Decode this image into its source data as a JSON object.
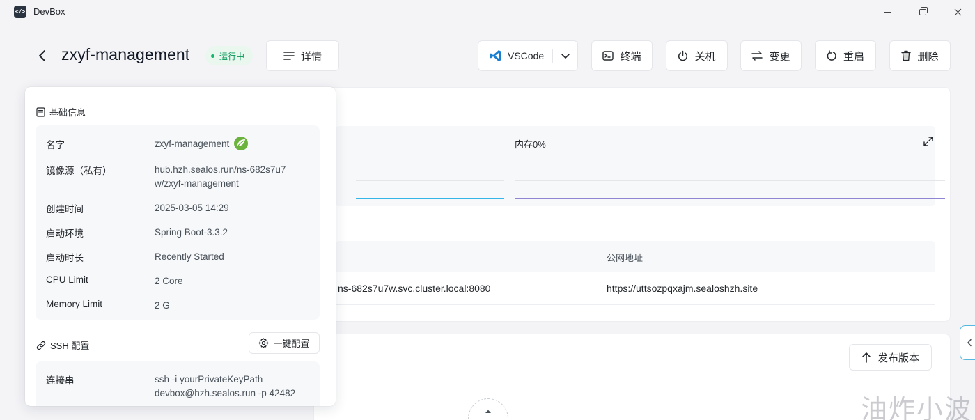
{
  "window": {
    "app_title": "DevBox",
    "app_icon": "code-icon"
  },
  "header": {
    "title": "zxyf-management",
    "status": "运行中",
    "status_color": "#12b76a"
  },
  "toolbar": {
    "detail_label": "详情",
    "vscode_label": "VSCode",
    "terminal_label": "终端",
    "shutdown_label": "关机",
    "change_label": "变更",
    "restart_label": "重启",
    "delete_label": "删除"
  },
  "monitor": {
    "memory_label": "内存0%",
    "cpu_line_color": "#36b6e6",
    "memory_line_color": "#8e86d3"
  },
  "network": {
    "public_header": "公网地址",
    "private_address": "ns-682s7u7w.svc.cluster.local:8080",
    "public_address": "https://uttsozpqxajm.sealoshzh.site"
  },
  "version": {
    "release_label": "发布版本"
  },
  "details": {
    "basic_title": "基础信息",
    "rows": [
      {
        "key": "名字",
        "value": "zxyf-management"
      },
      {
        "key": "镜像源（私有）",
        "value": "hub.hzh.sealos.run/ns-682s7u7w/zxyf-management"
      },
      {
        "key": "创建时间",
        "value": "2025-03-05 14:29"
      },
      {
        "key": "启动环境",
        "value": "Spring Boot-3.3.2"
      },
      {
        "key": "启动时长",
        "value": "Recently Started"
      },
      {
        "key": "CPU Limit",
        "value": "2 Core"
      },
      {
        "key": "Memory Limit",
        "value": "2 G"
      }
    ],
    "ssh_title": "SSH 配置",
    "onekey_label": "一键配置",
    "ssh_rows": [
      {
        "key": "连接串",
        "value": "ssh -i yourPrivateKeyPath devbox@hzh.sealos.run -p 42482"
      }
    ]
  },
  "watermark": "油炸小波"
}
